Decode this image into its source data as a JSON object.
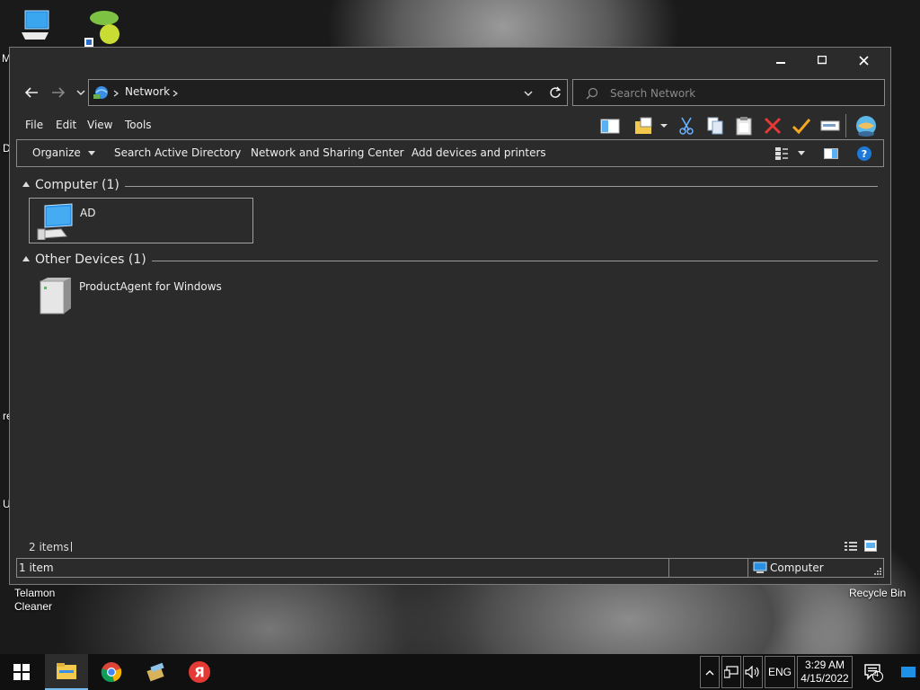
{
  "desktop": {
    "icons": [
      {
        "name": "this-pc-icon",
        "label": "M"
      },
      {
        "name": "telamon-cleaner-icon",
        "label": "Telamon Cleaner"
      },
      {
        "name": "recycle-bin-icon",
        "label": "Recycle Bin"
      }
    ],
    "edge_letters": [
      "D",
      "re",
      "U"
    ]
  },
  "window": {
    "controls": {
      "minimize": "minimize",
      "maximize": "maximize",
      "close": "close"
    },
    "address": {
      "location": "Network"
    },
    "search": {
      "placeholder": "Search Network"
    },
    "menu": [
      "File",
      "Edit",
      "View",
      "Tools"
    ],
    "toolbar_icons": [
      "layout-icon",
      "folder-properties-icon",
      "cut-icon",
      "copy-icon",
      "paste-icon",
      "delete-icon",
      "checkmark-icon",
      "rename-icon",
      "globe-icon"
    ],
    "commands": {
      "organize": "Organize",
      "search_ad": "Search Active Directory",
      "network_center": "Network and Sharing Center",
      "add_devices": "Add devices and printers"
    },
    "groups": [
      {
        "title": "Computer (1)",
        "items": [
          {
            "label": "AD",
            "icon": "computer-icon"
          }
        ]
      },
      {
        "title": "Other Devices (1)",
        "items": [
          {
            "label": "ProductAgent for Windows",
            "icon": "server-icon"
          }
        ]
      }
    ],
    "items_count": "2 items",
    "status": {
      "selection": "1 item",
      "zone": "Computer"
    }
  },
  "taskbar": {
    "apps": [
      "start-icon",
      "file-explorer-icon",
      "chrome-icon",
      "app-icon",
      "yandex-icon"
    ],
    "yandex_glyph": "Я",
    "language": "ENG",
    "time": "3:29 AM",
    "date": "4/15/2022",
    "notification_count": "4"
  }
}
